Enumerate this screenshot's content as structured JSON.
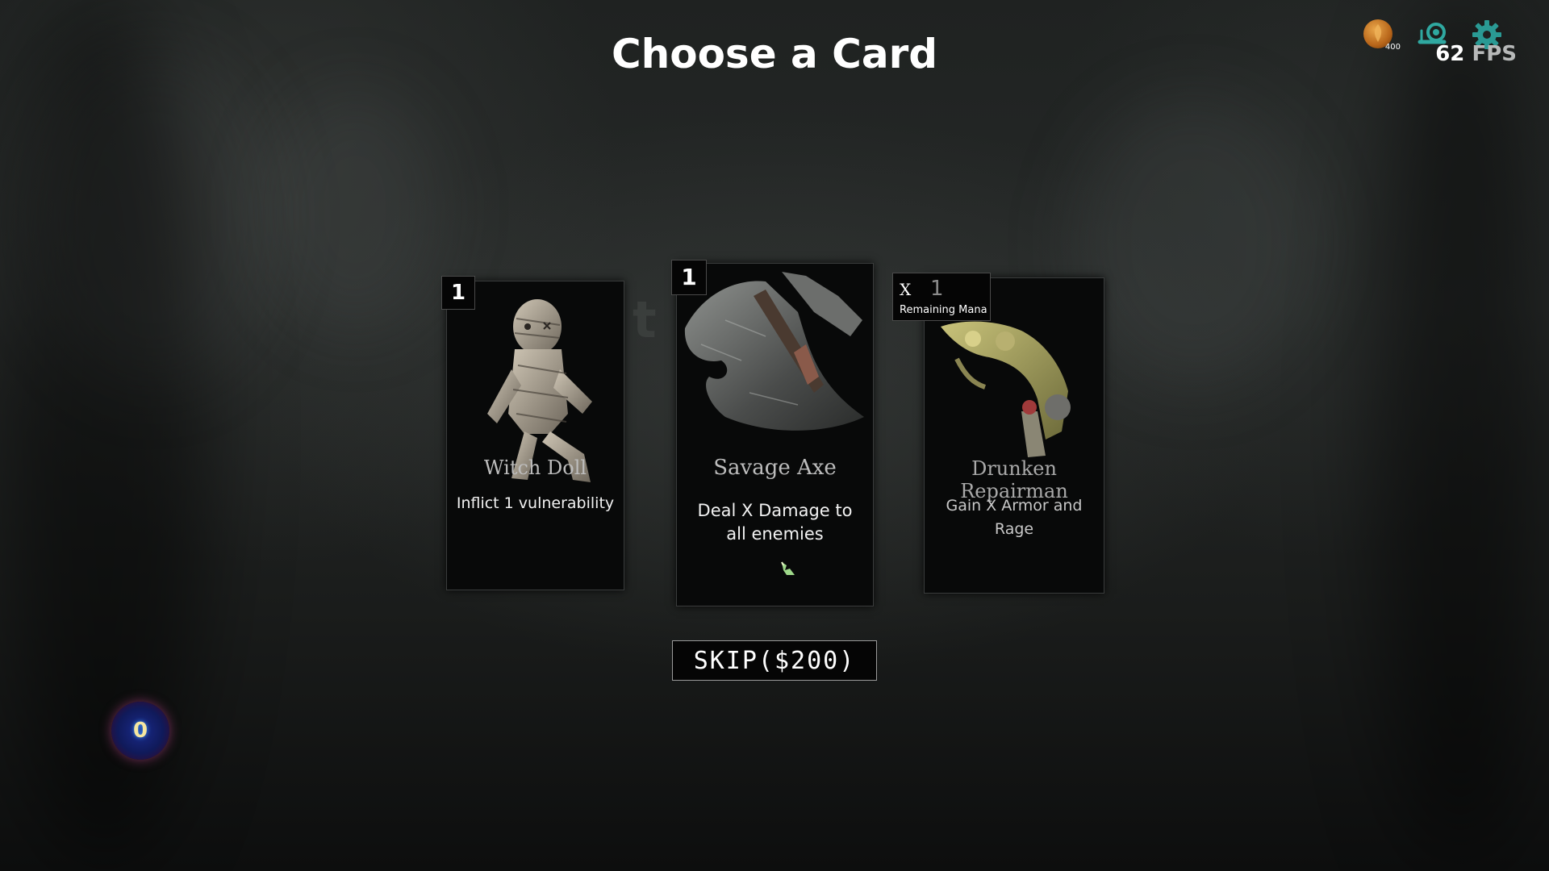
{
  "title": "Choose a Card",
  "hud": {
    "gold_icon": "gold-coin-icon",
    "gold_amount": "400",
    "speed_icon": "snail-icon",
    "settings_icon": "gear-icon",
    "fps_value": "62",
    "fps_unit": "FPS"
  },
  "cards": [
    {
      "cost": "1",
      "name": "Witch Doll",
      "description": "Inflict 1 vulnerability",
      "art": "witch-doll-icon"
    },
    {
      "cost": "1",
      "name": "Savage Axe",
      "description": "Deal X Damage to all enemies",
      "art": "axe-icon",
      "badge_icon": "leaf-icon"
    },
    {
      "cost_prefix": "X",
      "cost": "1",
      "cost_caption": "Remaining Mana",
      "name": "Drunken Repairman",
      "description": "Gain X Armor and Rage",
      "art": "mechanical-arm-icon"
    }
  ],
  "skip_label": "SKIP($200)",
  "orb_value": "0",
  "colors": {
    "background": "#1f2221",
    "card_bg": "#080909",
    "card_name": "#bdbdbd",
    "gold": "#c27a2a",
    "teal": "#2fa8a0"
  }
}
